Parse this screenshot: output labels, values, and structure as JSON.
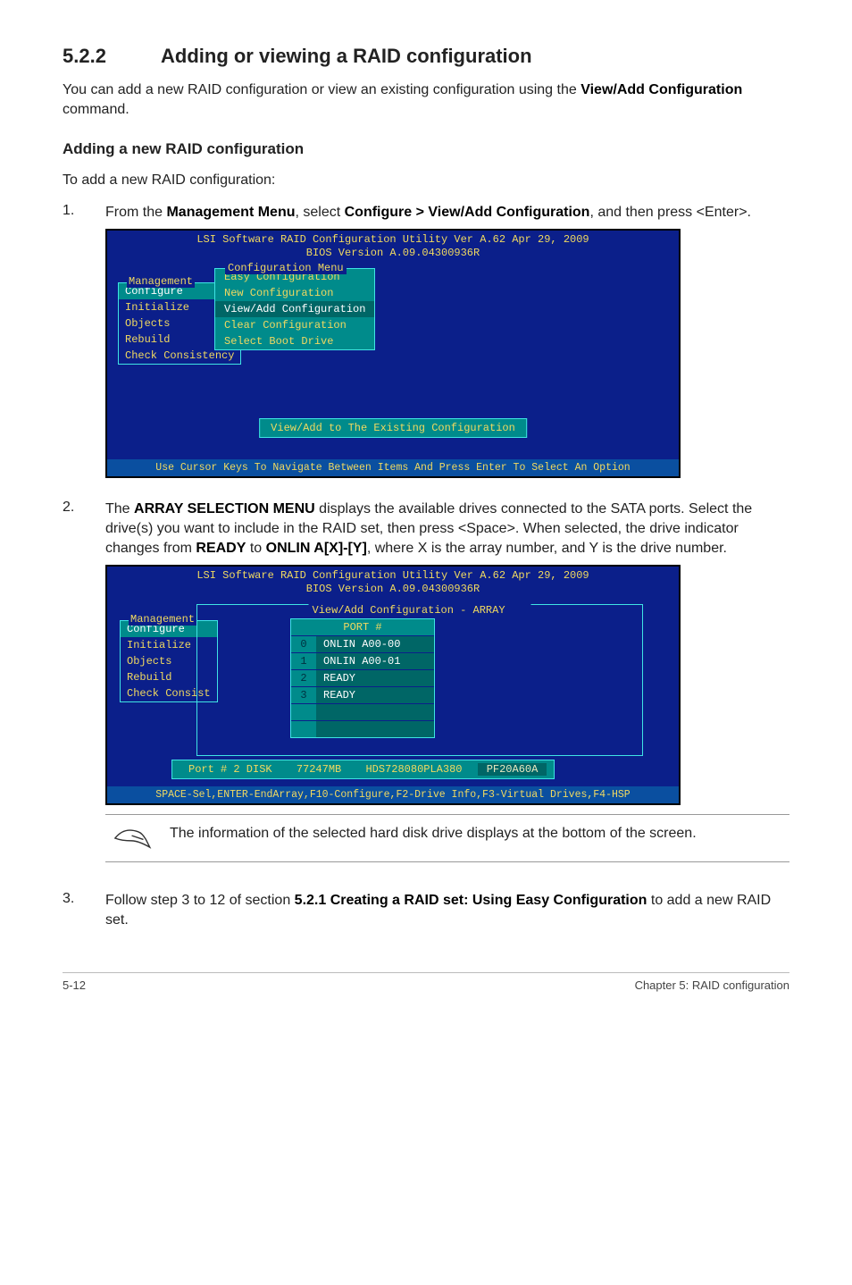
{
  "heading": {
    "number": "5.2.2",
    "title": "Adding or viewing a RAID configuration"
  },
  "intro": {
    "p1_a": "You can add a new RAID configuration or view an existing configuration using the ",
    "p1_bold": "View/Add Configuration",
    "p1_b": " command."
  },
  "subheading": "Adding a new RAID configuration",
  "sub_intro": "To add a new RAID configuration:",
  "steps": {
    "s1": {
      "num": "1.",
      "a": "From the ",
      "b1": "Management Menu",
      "c": ", select ",
      "b2": "Configure > View/Add Configuration",
      "d": ", and then press <Enter>."
    },
    "s2": {
      "num": "2.",
      "a": "The ",
      "b1": "ARRAY SELECTION MENU",
      "c": " displays the available drives connected to the SATA ports. Select the drive(s) you want to include in the RAID set, then press <Space>. When selected, the drive indicator changes from ",
      "b2": "READY",
      "d": " to ",
      "b3": "ONLIN A[X]-[Y]",
      "e": ", where X is the array number, and Y is the drive number."
    },
    "s3": {
      "num": "3.",
      "a": "Follow step 3 to 12 of section ",
      "b1": "5.2.1 Creating a RAID set: Using Easy Configuration",
      "c": " to add a new RAID set."
    }
  },
  "bios_common": {
    "title_line1": "LSI Software RAID Configuration Utility Ver A.62 Apr 29, 2009",
    "title_line2": "BIOS Version   A.09.04300936R"
  },
  "bios1": {
    "mgmt_label": "Management",
    "mgmt_items": [
      "Configure",
      "Initialize",
      "Objects",
      "Rebuild",
      "Check Consistency"
    ],
    "mgmt_selected": 0,
    "cfg_label": "Configuration Menu",
    "cfg_items": [
      "Easy Configuration",
      "New Configuration",
      "View/Add Configuration",
      "Clear Configuration",
      "Select Boot Drive"
    ],
    "cfg_selected": 2,
    "status": "View/Add to The Existing Configuration",
    "footer": "Use Cursor Keys To Navigate Between Items And Press Enter To Select An Option"
  },
  "bios2": {
    "mgmt_label": "Management",
    "mgmt_items": [
      "Configure",
      "Initialize",
      "Objects",
      "Rebuild",
      "Check Consist"
    ],
    "mgmt_selected": 0,
    "frame_label": "View/Add Configuration - ARRAY SELECTION MENU",
    "port_header": "PORT #",
    "ports": [
      {
        "idx": "0",
        "val": "ONLIN A00-00"
      },
      {
        "idx": "1",
        "val": "ONLIN A00-01"
      },
      {
        "idx": "2",
        "val": "READY"
      },
      {
        "idx": "3",
        "val": "READY"
      },
      {
        "idx": "",
        "val": ""
      },
      {
        "idx": "",
        "val": ""
      }
    ],
    "disk_info": [
      "Port # 2 DISK",
      "77247MB",
      "HDS728080PLA380",
      "PF20A60A"
    ],
    "footer": "SPACE-Sel,ENTER-EndArray,F10-Configure,F2-Drive Info,F3-Virtual Drives,F4-HSP"
  },
  "note": "The information of the selected hard disk drive displays at the bottom of the screen.",
  "pagefoot": {
    "left": "5-12",
    "right": "Chapter 5: RAID configuration"
  }
}
